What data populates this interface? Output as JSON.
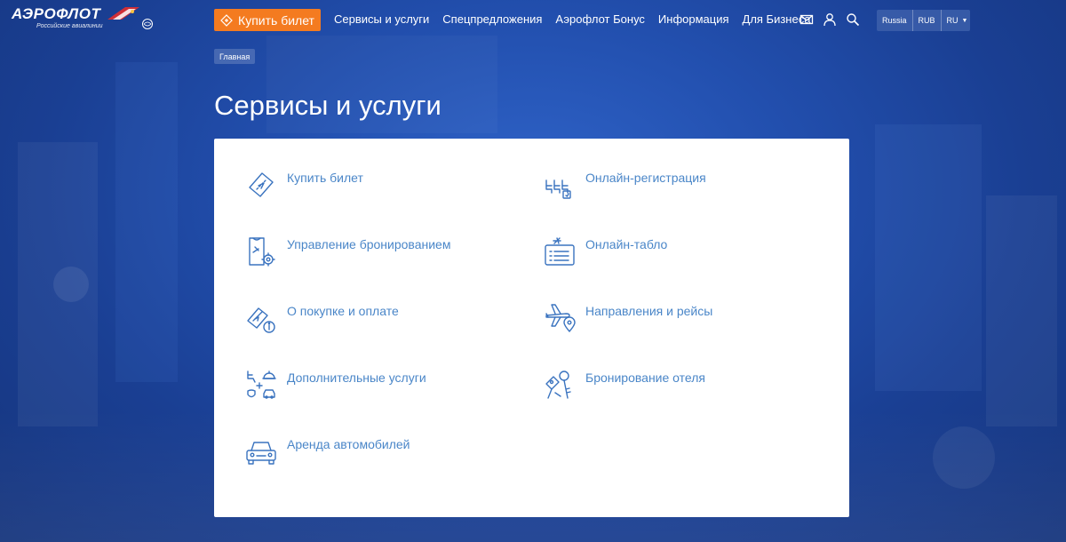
{
  "logo": {
    "word": "АЭРОФЛОТ",
    "sub": "Российские авиалинии"
  },
  "header": {
    "buy_label": "Купить билет",
    "nav": [
      "Сервисы и услуги",
      "Спецпредложения",
      "Аэрофлот Бонус",
      "Информация",
      "Для Бизнеса"
    ],
    "icons": [
      "mail-icon",
      "user-icon",
      "search-icon"
    ],
    "country": "Russia",
    "currency": "RUB",
    "language": "RU"
  },
  "breadcrumb": "Главная",
  "title": "Сервисы и услуги",
  "colors": {
    "accent": "#f47b20",
    "link": "#4a86c8",
    "icon": "#3a73bf"
  },
  "services": [
    {
      "label": "Купить билет",
      "icon": "ticket-icon"
    },
    {
      "label": "Онлайн-регистрация",
      "icon": "seats-icon"
    },
    {
      "label": "Управление бронированием",
      "icon": "booking-settings-icon"
    },
    {
      "label": "Онлайн-табло",
      "icon": "flight-board-icon"
    },
    {
      "label": "О покупке и оплате",
      "icon": "payment-info-icon"
    },
    {
      "label": "Направления и рейсы",
      "icon": "plane-location-icon"
    },
    {
      "label": "Дополнительные услуги",
      "icon": "extra-services-icon"
    },
    {
      "label": "Бронирование отеля",
      "icon": "hotel-keys-icon"
    },
    {
      "label": "Аренда автомобилей",
      "icon": "car-icon"
    }
  ]
}
